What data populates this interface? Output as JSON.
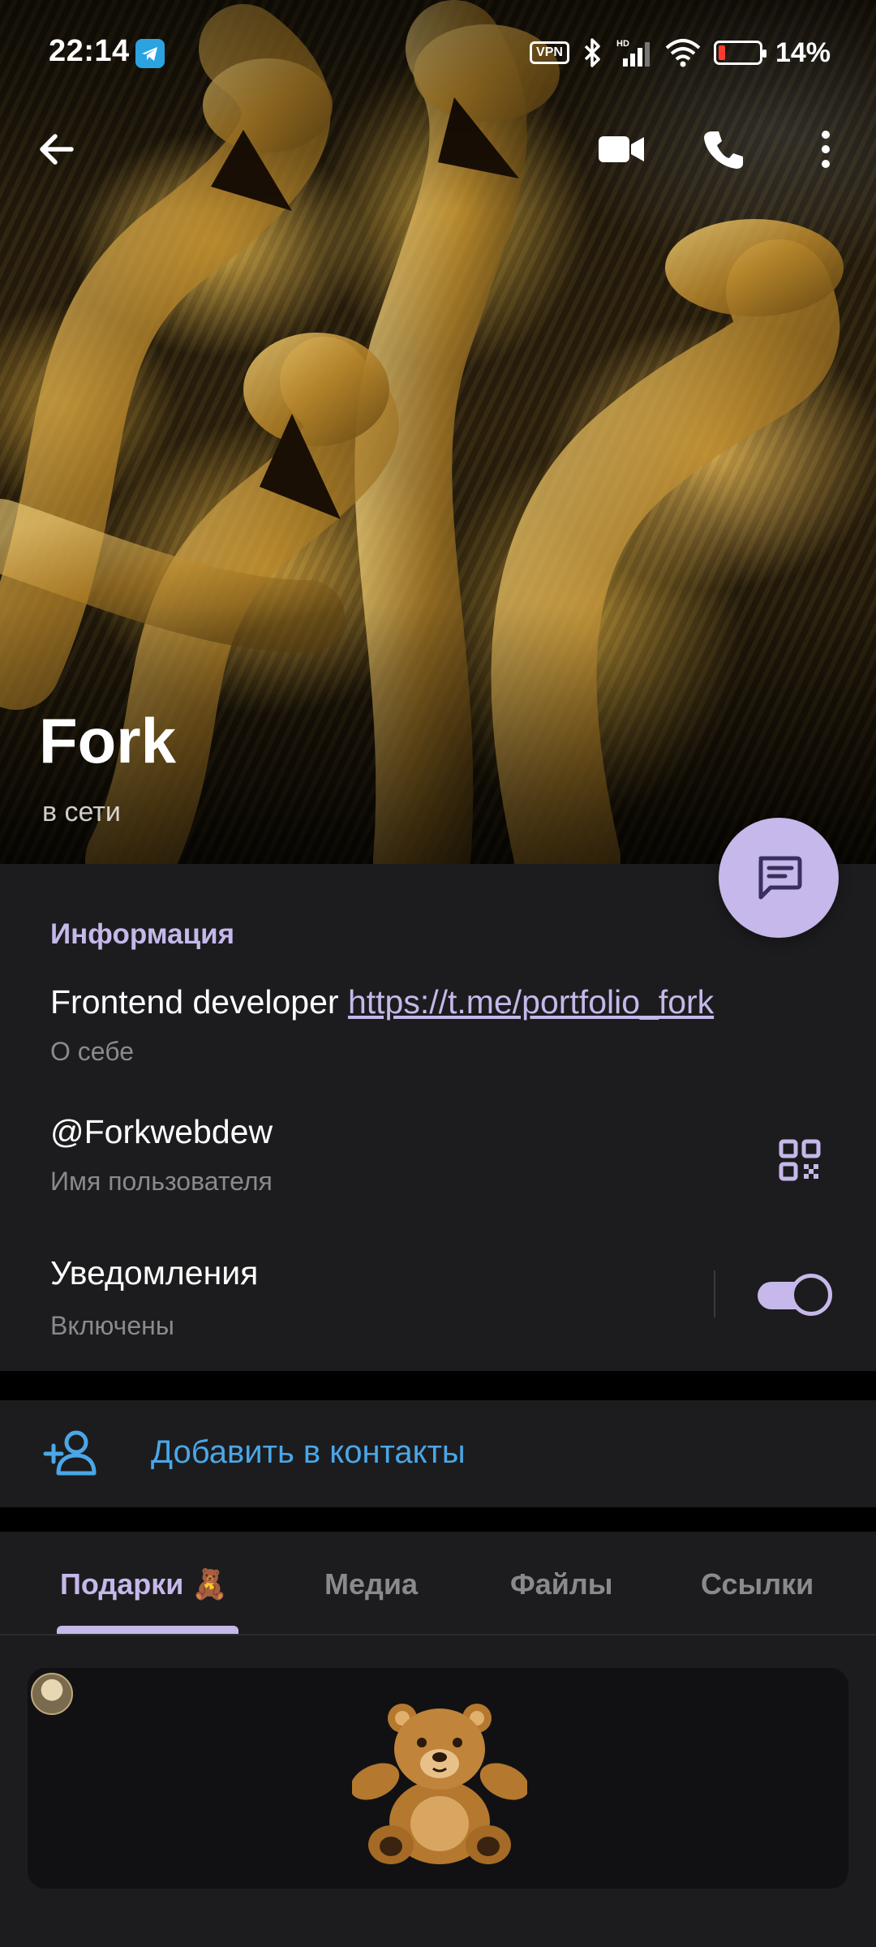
{
  "status_bar": {
    "time": "22:14",
    "vpn_label": "VPN",
    "battery_percent": "14%",
    "battery_level": 0.14,
    "icons": [
      "telegram-icon",
      "vpn-icon",
      "bluetooth-icon",
      "signal-icon",
      "wifi-icon",
      "battery-icon"
    ]
  },
  "toolbar": {
    "back_icon": "arrow-left-icon",
    "video_call_icon": "video-camera-icon",
    "call_icon": "phone-icon",
    "more_icon": "more-vertical-icon"
  },
  "profile": {
    "name": "Fork",
    "status": "в сети"
  },
  "info": {
    "section_title": "Информация",
    "bio_text": "Frontend developer ",
    "bio_link": "https://t.me/portfolio_fork",
    "bio_caption": "О себе",
    "username": "@Forkwebdew",
    "username_caption": "Имя пользователя",
    "notifications_title": "Уведомления",
    "notifications_state": "Включены",
    "notifications_enabled": true
  },
  "actions": {
    "add_contact": "Добавить в контакты"
  },
  "tabs": [
    {
      "label": "Подарки 🧸",
      "active": true
    },
    {
      "label": "Медиа",
      "active": false
    },
    {
      "label": "Файлы",
      "active": false
    },
    {
      "label": "Ссылки",
      "active": false
    }
  ],
  "colors": {
    "accent": "#c6b8ea",
    "link_blue": "#4aa7e8",
    "background": "#1c1c1e",
    "secondary_text": "#8a8a8e"
  }
}
